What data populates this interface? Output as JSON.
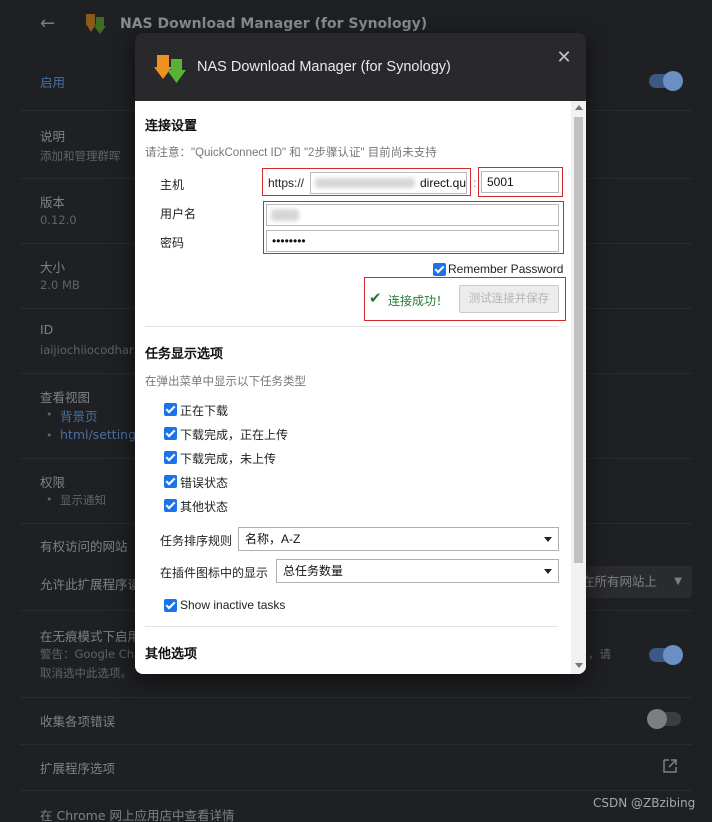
{
  "background": {
    "title": "NAS Download Manager (for Synology)",
    "enabled_label": "启用",
    "description_label": "说明",
    "description_value": "添加和管理群晖",
    "version_label": "版本",
    "version_value": "0.12.0",
    "size_label": "大小",
    "size_value": "2.0 MB",
    "id_label": "ID",
    "id_value": "iaijiochiiocodhar",
    "views_label": "查看视图",
    "view_items": [
      "背景页",
      "html/settings"
    ],
    "permissions_label": "权限",
    "permission_items": [
      "显示通知"
    ],
    "site_access_label": "有权访问的网站",
    "allow_access_label": "允许此扩展程序读",
    "site_access_select": "在所有网站上",
    "incognito_label": "在无痕模式下启用",
    "incognito_warning_line1": "警告：Google Ch",
    "incognito_warning_right": "，请",
    "incognito_warning_line2": "取消选中此选项。",
    "collect_errors_label": "收集各项错误",
    "extension_options_label": "扩展程序选项",
    "webstore_label": "在 Chrome 网上应用店中查看详情",
    "watermark": "CSDN @ZBzibing"
  },
  "dialog": {
    "title": "NAS Download Manager (for Synology)",
    "connection": {
      "heading": "连接设置",
      "notice": "请注意：\"QuickConnect ID\" 和 \"2步骤认证\" 目前尚未支持",
      "host_label": "主机",
      "protocol": "https://",
      "host_value": "direct.qu",
      "port_separator": ":",
      "port_value": "5001",
      "username_label": "用户名",
      "password_label": "密码",
      "password_value": "••••••••",
      "remember_label": "Remember Password",
      "success_text": "连接成功！",
      "test_button": "测试连接并保存"
    },
    "tasks": {
      "heading": "任务显示选项",
      "hint": "在弹出菜单中显示以下任务类型",
      "types": [
        "正在下载",
        "下载完成，正在上传",
        "下载完成，未上传",
        "错误状态",
        "其他状态"
      ],
      "sort_label": "任务排序规则",
      "sort_value": "名称，A-Z",
      "badge_label": "在插件图标中的显示",
      "badge_value": "总任务数量",
      "inactive_label": "Show inactive tasks"
    },
    "other": {
      "heading": "其他选项"
    }
  },
  "colors": {
    "accent": "#1a73e8",
    "highlight_box": "#d3282e",
    "success": "#1e7e34"
  }
}
